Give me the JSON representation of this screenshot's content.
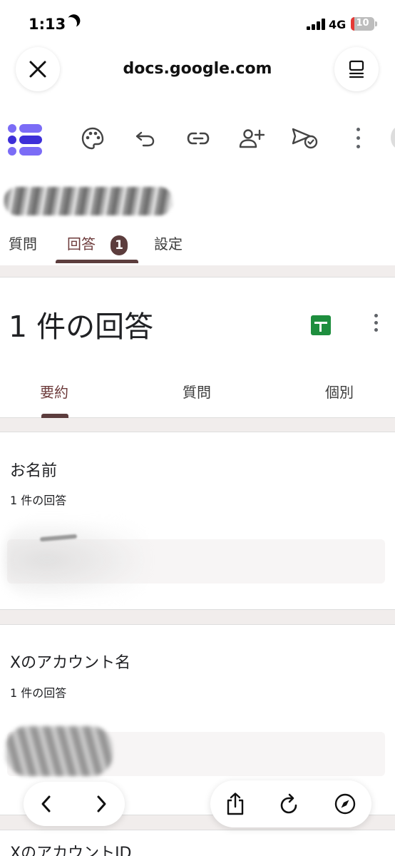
{
  "status_bar": {
    "time": "1:13",
    "network": "4G",
    "battery_level": "10"
  },
  "browser": {
    "url": "docs.google.com"
  },
  "toolbar": {
    "icons": [
      "palette-icon",
      "undo-icon",
      "link-icon",
      "add-collaborator-icon",
      "send-icon",
      "more-vert-icon"
    ]
  },
  "form_tabs": {
    "questions": "質問",
    "responses": "回答",
    "responses_badge": "1",
    "settings": "設定"
  },
  "summary": {
    "count_title": "1 件の回答",
    "subtabs": {
      "summary": "要約",
      "question": "質問",
      "individual": "個別"
    }
  },
  "questions": [
    {
      "title": "お名前",
      "count": "1 件の回答"
    },
    {
      "title": "Xのアカウント名",
      "count": "1 件の回答"
    },
    {
      "title": "XのアカウントID"
    }
  ],
  "colors": {
    "accent": "#5c3d3d",
    "sheets_green": "#1e8e3e",
    "background": "#f1edec"
  }
}
